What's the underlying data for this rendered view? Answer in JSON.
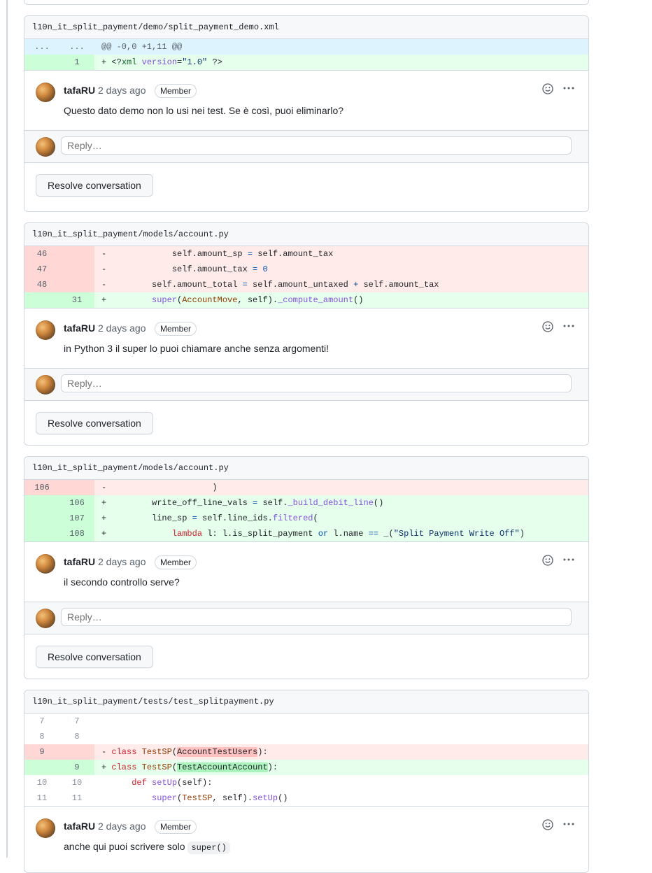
{
  "threads": [
    {
      "file": "l10n_it_split_payment/demo/split_payment_demo.xml",
      "lines": [
        {
          "type": "hunk",
          "old": "...",
          "new": "...",
          "code": "@@ -0,0 +1,11 @@"
        },
        {
          "type": "add",
          "old": "",
          "new": "1",
          "code": "+ <?xml version=\"1.0\" ?>"
        }
      ],
      "comment": {
        "author": "tafaRU",
        "ago": "2 days ago",
        "badge": "Member",
        "body": "Questo dato demo non lo usi nei test. Se è così, puoi eliminarlo?"
      }
    },
    {
      "file": "l10n_it_split_payment/models/account.py",
      "lines": [
        {
          "type": "del",
          "old": "46",
          "new": "",
          "code": "-             self.amount_sp = self.amount_tax"
        },
        {
          "type": "del",
          "old": "47",
          "new": "",
          "code": "-             self.amount_tax = 0"
        },
        {
          "type": "del",
          "old": "48",
          "new": "",
          "code": "-         self.amount_total = self.amount_untaxed + self.amount_tax"
        },
        {
          "type": "add",
          "old": "",
          "new": "31",
          "code": "+         super(AccountMove, self)._compute_amount()"
        }
      ],
      "comment": {
        "author": "tafaRU",
        "ago": "2 days ago",
        "badge": "Member",
        "body": "in Python 3 il super lo puoi chiamare anche senza argomenti!"
      }
    },
    {
      "file": "l10n_it_split_payment/models/account.py",
      "lines": [
        {
          "type": "del",
          "old": "106",
          "new": "",
          "code": "-                     )"
        },
        {
          "type": "add",
          "old": "",
          "new": "106",
          "code": "+         write_off_line_vals = self._build_debit_line()"
        },
        {
          "type": "add",
          "old": "",
          "new": "107",
          "code": "+         line_sp = self.line_ids.filtered("
        },
        {
          "type": "add",
          "old": "",
          "new": "108",
          "code": "+             lambda l: l.is_split_payment or l.name == _(\"Split Payment Write Off\")"
        }
      ],
      "comment": {
        "author": "tafaRU",
        "ago": "2 days ago",
        "badge": "Member",
        "body": "il secondo controllo serve?"
      }
    },
    {
      "file": "l10n_it_split_payment/tests/test_splitpayment.py",
      "lines": [
        {
          "type": "ctx",
          "old": "7",
          "new": "7",
          "code": ""
        },
        {
          "type": "ctx",
          "old": "8",
          "new": "8",
          "code": ""
        },
        {
          "type": "del",
          "old": "9",
          "new": "",
          "code": "- class TestSP(AccountTestUsers):"
        },
        {
          "type": "add",
          "old": "",
          "new": "9",
          "code": "+ class TestSP(TestAccountAccount):"
        },
        {
          "type": "ctx",
          "old": "10",
          "new": "10",
          "code": "      def setUp(self):"
        },
        {
          "type": "ctx",
          "old": "11",
          "new": "11",
          "code": "          super(TestSP, self).setUp()"
        }
      ],
      "comment": {
        "author": "tafaRU",
        "ago": "2 days ago",
        "badge": "Member",
        "body": "anche qui puoi scrivere solo",
        "code": "super()"
      }
    }
  ],
  "reply_placeholder": "Reply…",
  "resolve_label": "Resolve conversation",
  "icons": {
    "emoji": "smiley-icon",
    "more": "kebab-horizontal-icon"
  },
  "colors": {
    "add_bg": "#e6ffec",
    "del_bg": "#ffebe9",
    "hunk_bg": "#ddf4ff",
    "border": "#d0d7de"
  }
}
